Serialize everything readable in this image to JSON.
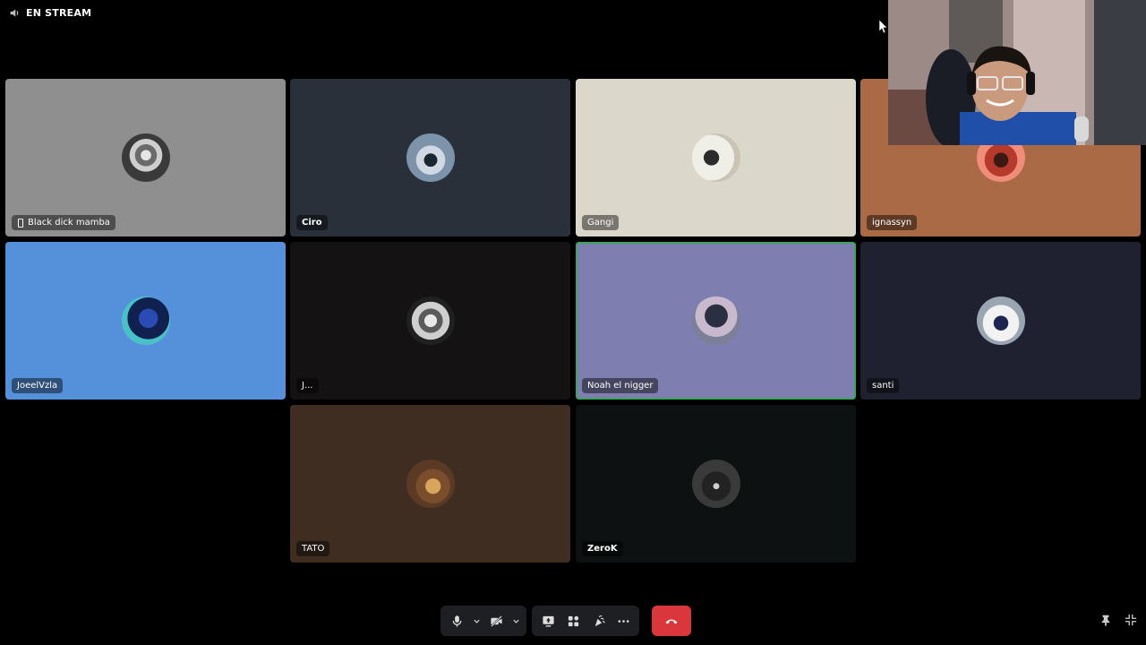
{
  "stream_header": {
    "label": "EN STREAM",
    "icon": "speaker-icon"
  },
  "participants": [
    {
      "name": "Black dick mamba",
      "bg": "#8f8f8f",
      "mobile": true,
      "speaking": false
    },
    {
      "name": "Ciro",
      "bg": "#29303a",
      "mobile": false,
      "speaking": false
    },
    {
      "name": "Gangi",
      "bg": "#dbd8cb",
      "mobile": false,
      "speaking": false
    },
    {
      "name": "ignassyn",
      "bg": "#a96a45",
      "mobile": false,
      "speaking": false
    },
    {
      "name": "JoeelVzla",
      "bg": "#5590da",
      "mobile": false,
      "speaking": false
    },
    {
      "name": "J...",
      "bg": "#141212",
      "mobile": false,
      "speaking": false
    },
    {
      "name": "Noah el nigger",
      "bg": "#7e7fb0",
      "mobile": false,
      "speaking": true
    },
    {
      "name": "santi",
      "bg": "#1f2130",
      "mobile": false,
      "speaking": false
    },
    {
      "name": "TATO",
      "bg": "#3f2d22",
      "mobile": false,
      "speaking": false
    },
    {
      "name": "ZeroK",
      "bg": "#0e1112",
      "mobile": false,
      "speaking": false
    }
  ],
  "controls": {
    "buttons": [
      "microphone-icon",
      "mic-options-chevron-icon",
      "camera-off-icon",
      "camera-options-chevron-icon",
      "screen-share-icon",
      "activities-icon",
      "soundboard-icon",
      "more-options-icon",
      "hang-up-icon"
    ],
    "hangup_color": "#da373c"
  },
  "corner_controls": [
    "pin-icon",
    "exit-fullscreen-icon"
  ],
  "colors": {
    "background": "#000000",
    "speaking_border": "#3ba55c",
    "toolbar": "#1e1f22"
  }
}
